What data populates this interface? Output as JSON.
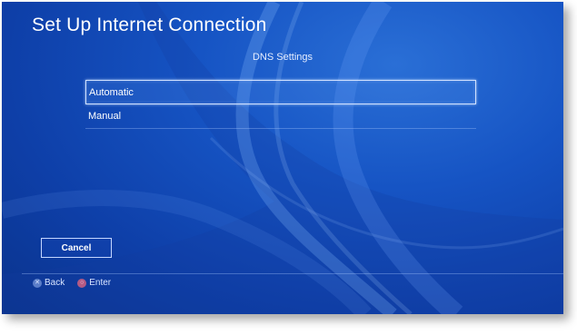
{
  "screen": {
    "title": "Set Up Internet Connection",
    "subtitle": "DNS Settings"
  },
  "options": [
    {
      "label": "Automatic",
      "selected": true
    },
    {
      "label": "Manual",
      "selected": false
    }
  ],
  "cancel_button": {
    "label": "Cancel"
  },
  "footer": {
    "back": {
      "icon": "cross-button-icon",
      "label": "Back"
    },
    "enter": {
      "icon": "circle-button-icon",
      "label": "Enter"
    }
  },
  "colors": {
    "background": "#1654c4",
    "text": "#ffffff",
    "highlight_border": "#cfe0ff"
  }
}
